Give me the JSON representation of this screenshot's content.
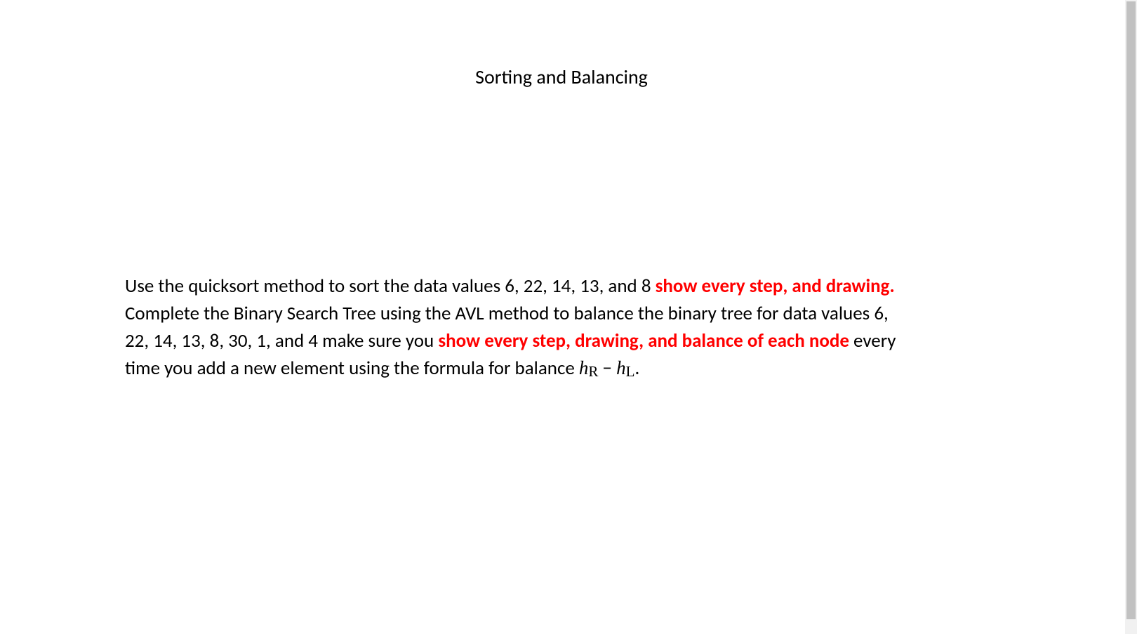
{
  "title": "Sorting and Balancing",
  "paragraphs": {
    "p1_part1": "Use the quicksort method to sort the data values 6, 22, 14, 13, and 8 ",
    "p1_emph": "show every step, and drawing.",
    "p2_part1": "Complete the Binary Search Tree using the AVL method to balance the binary tree for data values 6, 22, 14, 13, 8, 30, 1, and 4 make sure you ",
    "p2_emph": "show every step, drawing, and balance of each node",
    "p2_part2": " every time you add a new element using the formula for balance ",
    "formula_h1": "h",
    "formula_sub1": "R",
    "formula_minus": " − ",
    "formula_h2": "h",
    "formula_sub2": "L",
    "formula_period": "."
  }
}
